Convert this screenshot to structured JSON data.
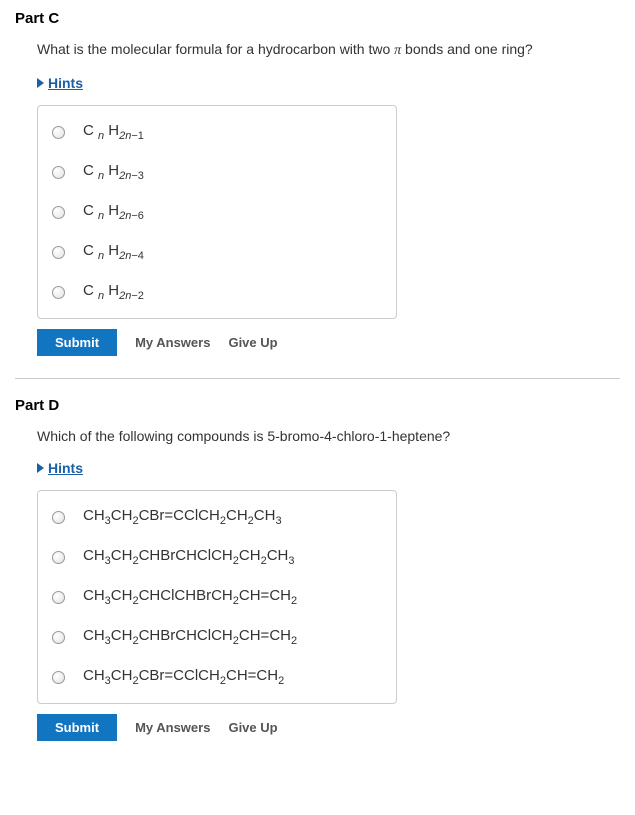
{
  "parts": [
    {
      "title": "Part C",
      "question_plain": "What is the molecular formula for a hydrocarbon with two ",
      "question_pi": "π",
      "question_after": " bonds and one ring?",
      "hints_label": "Hints",
      "options": [
        {
          "C": "C",
          "n": "n",
          "H": "H",
          "sub": "2n−1"
        },
        {
          "C": "C",
          "n": "n",
          "H": "H",
          "sub": "2n−3"
        },
        {
          "C": "C",
          "n": "n",
          "H": "H",
          "sub": "2n−6"
        },
        {
          "C": "C",
          "n": "n",
          "H": "H",
          "sub": "2n−4"
        },
        {
          "C": "C",
          "n": "n",
          "H": "H",
          "sub": "2n−2"
        }
      ],
      "submit_label": "Submit",
      "my_answers_label": "My Answers",
      "give_up_label": "Give Up"
    },
    {
      "title": "Part D",
      "question_plain": "Which of the following compounds is 5-bromo-4-chloro-1-heptene?",
      "hints_label": "Hints",
      "options_d": [
        [
          {
            "t": "CH",
            "s": ""
          },
          {
            "t": "3",
            "s": "sub"
          },
          {
            "t": "CH",
            "s": ""
          },
          {
            "t": "2",
            "s": "sub"
          },
          {
            "t": "CBr=CClCH",
            "s": ""
          },
          {
            "t": "2",
            "s": "sub"
          },
          {
            "t": "CH",
            "s": ""
          },
          {
            "t": "2",
            "s": "sub"
          },
          {
            "t": "CH",
            "s": ""
          },
          {
            "t": "3",
            "s": "sub"
          }
        ],
        [
          {
            "t": "CH",
            "s": ""
          },
          {
            "t": "3",
            "s": "sub"
          },
          {
            "t": "CH",
            "s": ""
          },
          {
            "t": "2",
            "s": "sub"
          },
          {
            "t": "CHBrCHClCH",
            "s": ""
          },
          {
            "t": "2",
            "s": "sub"
          },
          {
            "t": "CH",
            "s": ""
          },
          {
            "t": "2",
            "s": "sub"
          },
          {
            "t": "CH",
            "s": ""
          },
          {
            "t": "3",
            "s": "sub"
          }
        ],
        [
          {
            "t": "CH",
            "s": ""
          },
          {
            "t": "3",
            "s": "sub"
          },
          {
            "t": "CH",
            "s": ""
          },
          {
            "t": "2",
            "s": "sub"
          },
          {
            "t": "CHClCHBrCH",
            "s": ""
          },
          {
            "t": "2",
            "s": "sub"
          },
          {
            "t": "CH=CH",
            "s": ""
          },
          {
            "t": "2",
            "s": "sub"
          }
        ],
        [
          {
            "t": "CH",
            "s": ""
          },
          {
            "t": "3",
            "s": "sub"
          },
          {
            "t": "CH",
            "s": ""
          },
          {
            "t": "2",
            "s": "sub"
          },
          {
            "t": "CHBrCHClCH",
            "s": ""
          },
          {
            "t": "2",
            "s": "sub"
          },
          {
            "t": "CH=CH",
            "s": ""
          },
          {
            "t": "2",
            "s": "sub"
          }
        ],
        [
          {
            "t": "CH",
            "s": ""
          },
          {
            "t": "3",
            "s": "sub"
          },
          {
            "t": "CH",
            "s": ""
          },
          {
            "t": "2",
            "s": "sub"
          },
          {
            "t": "CBr=CClCH",
            "s": ""
          },
          {
            "t": "2",
            "s": "sub"
          },
          {
            "t": "CH=CH",
            "s": ""
          },
          {
            "t": "2",
            "s": "sub"
          }
        ]
      ],
      "submit_label": "Submit",
      "my_answers_label": "My Answers",
      "give_up_label": "Give Up"
    }
  ]
}
